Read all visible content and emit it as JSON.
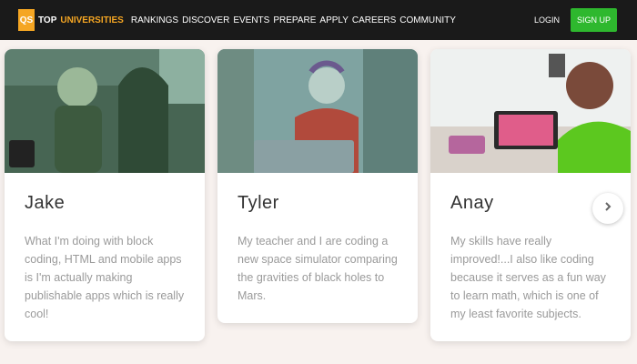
{
  "brand": {
    "badge": "QS",
    "top": "TOP",
    "universities": "UNIVERSITIES"
  },
  "nav": [
    "RANKINGS",
    "DISCOVER",
    "EVENTS",
    "PREPARE",
    "APPLY",
    "CAREERS",
    "COMMUNITY"
  ],
  "auth": {
    "login": "LOGIN",
    "signup": "SIGN UP"
  },
  "cards": [
    {
      "name": "Jake",
      "text": "What I'm doing with block coding, HTML and mobile apps is I'm actually making publishable apps which is really cool!"
    },
    {
      "name": "Tyler",
      "text": "My teacher and I are coding a new space simulator comparing the gravities of black holes to Mars."
    },
    {
      "name": "Anay",
      "text": "My skills have really improved!...I also like coding because it serves as a fun way to learn math, which is one of my least favorite subjects."
    }
  ],
  "next_icon": "chevron-right-icon"
}
